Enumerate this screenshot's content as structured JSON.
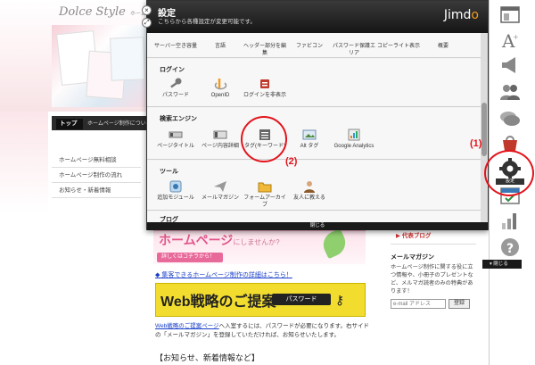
{
  "site": {
    "logo": "Dolce Style",
    "logo_sub": "ホーム",
    "nav_home": "トップ",
    "nav_link": "ホームページ制作について",
    "side_links": [
      "ホームページ無料相談",
      "ホームページ制作の流れ",
      "お知らせ・新着情報"
    ],
    "banner_a_main": "ホームページ",
    "banner_a_small": "にしませんか?",
    "banner_a_button": "詳しくはコチラから！",
    "promo_link": "◆ 集客できるホームページ制作の詳細はこちら！",
    "banner_b_text": "Web戦略のご提案",
    "banner_b_password": "パスワード",
    "note_link": "Web戦略のご提案ページ",
    "note_text": "へ入室するには、パスワードが必要になります。右サイドの「メールマガジン」を登録していただければ、お知らせいたします。",
    "section_heading": "【お知らせ、新着情報など】",
    "right": {
      "blog": "代表ブログ",
      "mm_title": "メールマガジン",
      "mm_text": "ホームページ制作に関する役に立つ情報や、小冊子のプレゼントなど、メルマガ読者のみの特典があります！",
      "email_placeholder": "e-mail アドレス",
      "register": "登録"
    }
  },
  "panel": {
    "title": "設定",
    "subtitle": "こちらから各種設定が変更可能です。",
    "brand": "Jimdo",
    "footer": "閉じる",
    "top_items": [
      "サーバー空き容量",
      "言語",
      "ヘッダー部分を編集",
      "ファビコン",
      "パスワード保護エリア",
      "コピーライト表示",
      "概要"
    ],
    "sections": [
      {
        "title": "ログイン",
        "items": [
          "パスワード",
          "OpenID",
          "ログインを非表示"
        ]
      },
      {
        "title": "検索エンジン",
        "items": [
          "ページタイトル",
          "ページ内容詳細",
          "タグ(キーワード)",
          "Alt タグ",
          "Google Analytics"
        ]
      },
      {
        "title": "ツール",
        "items": [
          "追加モジュール",
          "メールマガジン",
          "フォームアーカイブ",
          "友人に教える"
        ]
      },
      {
        "title": "ブログ",
        "items": []
      }
    ]
  },
  "sidebar": {
    "close": "閉じる",
    "settings_label": "設定",
    "icons": [
      "layout-icon",
      "font-icon",
      "megaphone-icon",
      "users-icon",
      "chat-icon",
      "shop-icon",
      "settings-icon",
      "calendar-icon",
      "stats-icon",
      "help-icon"
    ]
  },
  "annotations": {
    "callout_1": "(1)",
    "callout_2": "(2)"
  },
  "colors": {
    "callout": "#e3141c",
    "header_dark": "#1a1a1a",
    "jimdo_orange": "#f29b1e"
  }
}
